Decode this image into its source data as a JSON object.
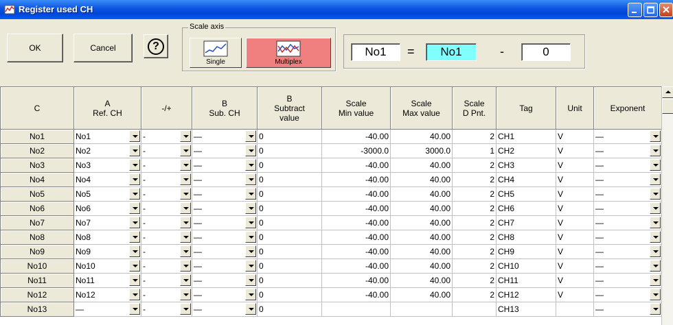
{
  "window": {
    "title": "Register used CH"
  },
  "toolbar": {
    "ok_label": "OK",
    "cancel_label": "Cancel",
    "help_label": "?",
    "scale_axis_label": "Scale axis",
    "single_label": "Single",
    "multiplex_label": "Multiplex",
    "multiplex_active_color": "#f08080"
  },
  "formula": {
    "a": "No1",
    "eq": "=",
    "b": "No1",
    "op": "-",
    "c": "0"
  },
  "table": {
    "headers": [
      [
        "C"
      ],
      [
        "A",
        "Ref. CH"
      ],
      [
        "-/+"
      ],
      [
        "B",
        "Sub. CH"
      ],
      [
        "B",
        "Subtract",
        "value"
      ],
      [
        "Scale",
        "Min value"
      ],
      [
        "Scale",
        "Max value"
      ],
      [
        "Scale",
        "D Pnt."
      ],
      [
        "Tag"
      ],
      [
        "Unit"
      ],
      [
        "Exponent"
      ]
    ],
    "rows": [
      {
        "c": "No1",
        "ref": "No1",
        "sign": "-",
        "sub": "—",
        "subval": "0",
        "min": "-40.00",
        "max": "40.00",
        "dpnt": "2",
        "tag": "CH1",
        "unit": "V",
        "exp": "—"
      },
      {
        "c": "No2",
        "ref": "No2",
        "sign": "-",
        "sub": "—",
        "subval": "0",
        "min": "-3000.0",
        "max": "3000.0",
        "dpnt": "1",
        "tag": "CH2",
        "unit": "V",
        "exp": "—"
      },
      {
        "c": "No3",
        "ref": "No3",
        "sign": "-",
        "sub": "—",
        "subval": "0",
        "min": "-40.00",
        "max": "40.00",
        "dpnt": "2",
        "tag": "CH3",
        "unit": "V",
        "exp": "—"
      },
      {
        "c": "No4",
        "ref": "No4",
        "sign": "-",
        "sub": "—",
        "subval": "0",
        "min": "-40.00",
        "max": "40.00",
        "dpnt": "2",
        "tag": "CH4",
        "unit": "V",
        "exp": "—"
      },
      {
        "c": "No5",
        "ref": "No5",
        "sign": "-",
        "sub": "—",
        "subval": "0",
        "min": "-40.00",
        "max": "40.00",
        "dpnt": "2",
        "tag": "CH5",
        "unit": "V",
        "exp": "—"
      },
      {
        "c": "No6",
        "ref": "No6",
        "sign": "-",
        "sub": "—",
        "subval": "0",
        "min": "-40.00",
        "max": "40.00",
        "dpnt": "2",
        "tag": "CH6",
        "unit": "V",
        "exp": "—"
      },
      {
        "c": "No7",
        "ref": "No7",
        "sign": "-",
        "sub": "—",
        "subval": "0",
        "min": "-40.00",
        "max": "40.00",
        "dpnt": "2",
        "tag": "CH7",
        "unit": "V",
        "exp": "—"
      },
      {
        "c": "No8",
        "ref": "No8",
        "sign": "-",
        "sub": "—",
        "subval": "0",
        "min": "-40.00",
        "max": "40.00",
        "dpnt": "2",
        "tag": "CH8",
        "unit": "V",
        "exp": "—"
      },
      {
        "c": "No9",
        "ref": "No9",
        "sign": "-",
        "sub": "—",
        "subval": "0",
        "min": "-40.00",
        "max": "40.00",
        "dpnt": "2",
        "tag": "CH9",
        "unit": "V",
        "exp": "—"
      },
      {
        "c": "No10",
        "ref": "No10",
        "sign": "-",
        "sub": "—",
        "subval": "0",
        "min": "-40.00",
        "max": "40.00",
        "dpnt": "2",
        "tag": "CH10",
        "unit": "V",
        "exp": "—"
      },
      {
        "c": "No11",
        "ref": "No11",
        "sign": "-",
        "sub": "—",
        "subval": "0",
        "min": "-40.00",
        "max": "40.00",
        "dpnt": "2",
        "tag": "CH11",
        "unit": "V",
        "exp": "—"
      },
      {
        "c": "No12",
        "ref": "No12",
        "sign": "-",
        "sub": "—",
        "subval": "0",
        "min": "-40.00",
        "max": "40.00",
        "dpnt": "2",
        "tag": "CH12",
        "unit": "V",
        "exp": "—"
      },
      {
        "c": "No13",
        "ref": "—",
        "sign": "-",
        "sub": "—",
        "subval": "0",
        "min": "",
        "max": "",
        "dpnt": "",
        "tag": "CH13",
        "unit": "",
        "exp": "—"
      }
    ]
  }
}
